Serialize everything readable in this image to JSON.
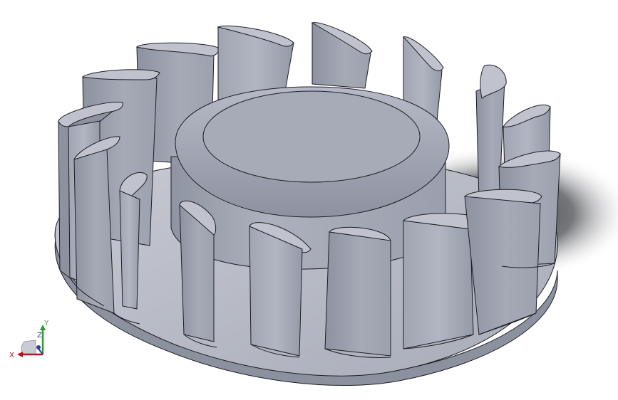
{
  "viewport": {
    "background": "#ffffff",
    "model_color": "#a9aebd",
    "edge_color": "#1c1e24"
  },
  "triad": {
    "x_label": "X",
    "y_label": "Y",
    "z_label": "Z",
    "x_color": "#b3131b",
    "y_color": "#2a9a2a",
    "z_color": "#2b3f9e"
  }
}
